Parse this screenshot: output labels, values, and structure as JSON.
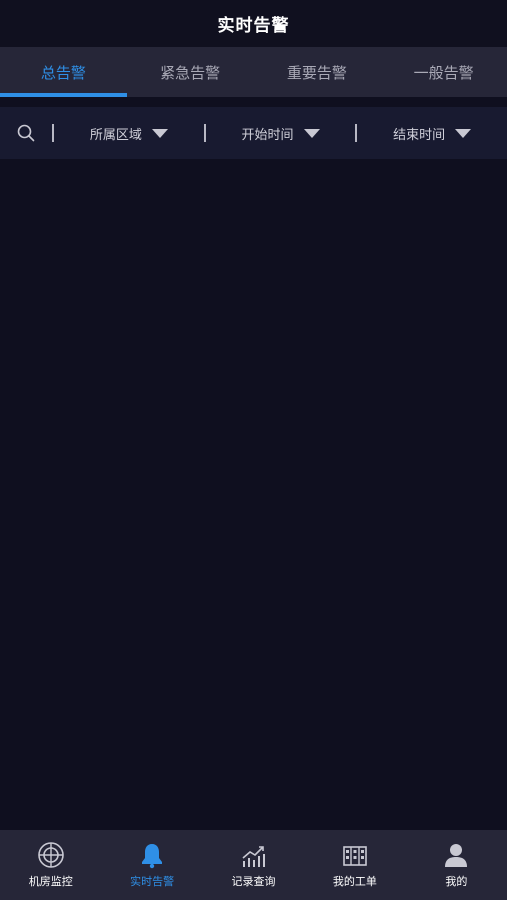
{
  "header": {
    "title": "实时告警"
  },
  "tabs": [
    {
      "label": "总告警",
      "active": true
    },
    {
      "label": "紧急告警",
      "active": false
    },
    {
      "label": "重要告警",
      "active": false
    },
    {
      "label": "一般告警",
      "active": false
    }
  ],
  "filters": {
    "search_icon": "search-icon",
    "area_label": "所属区域",
    "start_label": "开始时间",
    "end_label": "结束时间"
  },
  "bottom_nav": [
    {
      "label": "机房监控",
      "icon": "target-icon",
      "active": false
    },
    {
      "label": "实时告警",
      "icon": "bell-icon",
      "active": true
    },
    {
      "label": "记录查询",
      "icon": "chart-icon",
      "active": false
    },
    {
      "label": "我的工单",
      "icon": "building-icon",
      "active": false
    },
    {
      "label": "我的",
      "icon": "user-icon",
      "active": false
    }
  ],
  "colors": {
    "accent": "#2f8fe6",
    "background": "#0f0f1f",
    "bar": "#262638",
    "filter_bar": "#181a30"
  }
}
